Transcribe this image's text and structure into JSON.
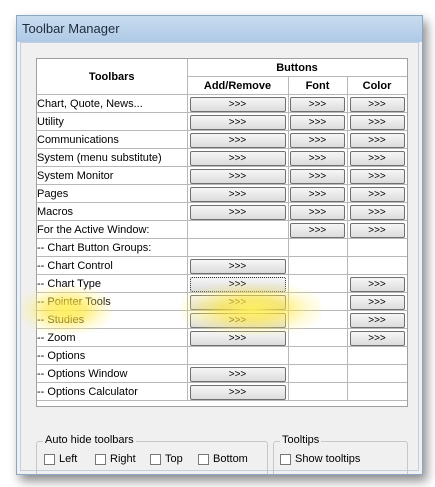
{
  "window": {
    "title": "Toolbar Manager"
  },
  "table": {
    "toolbars_header": "Toolbars",
    "buttons_header": "Buttons",
    "columns": [
      "Add/Remove",
      "Font",
      "Color"
    ],
    "button_label": ">>>",
    "rows": [
      {
        "label": "Chart, Quote, News...",
        "add": true,
        "font": true,
        "color": true
      },
      {
        "label": "Utility",
        "add": true,
        "font": true,
        "color": true
      },
      {
        "label": "Communications",
        "add": true,
        "font": true,
        "color": true
      },
      {
        "label": "System (menu substitute)",
        "add": true,
        "font": true,
        "color": true
      },
      {
        "label": "System Monitor",
        "add": true,
        "font": true,
        "color": true
      },
      {
        "label": "Pages",
        "add": true,
        "font": true,
        "color": true
      },
      {
        "label": "Macros",
        "add": true,
        "font": true,
        "color": true
      },
      {
        "label": "For the Active Window:",
        "add": false,
        "font": true,
        "color": true
      },
      {
        "label": "-- Chart Button Groups:",
        "add": false,
        "font": false,
        "color": false
      },
      {
        "label": "-- Chart Control",
        "add": true,
        "font": false,
        "color": false
      },
      {
        "label": "-- Chart Type",
        "add": true,
        "font": false,
        "color": true,
        "focused": true
      },
      {
        "label": "-- Pointer Tools",
        "add": true,
        "font": false,
        "color": true
      },
      {
        "label": "-- Studies",
        "add": true,
        "font": false,
        "color": true
      },
      {
        "label": "-- Zoom",
        "add": true,
        "font": false,
        "color": true
      },
      {
        "label": "-- Options",
        "add": false,
        "font": false,
        "color": false
      },
      {
        "label": "-- Options Window",
        "add": true,
        "font": false,
        "color": false
      },
      {
        "label": "-- Options Calculator",
        "add": true,
        "font": false,
        "color": false
      }
    ]
  },
  "auto_hide": {
    "legend": "Auto hide toolbars",
    "options": [
      {
        "label": "Left",
        "checked": false
      },
      {
        "label": "Right",
        "checked": false
      },
      {
        "label": "Top",
        "checked": false
      },
      {
        "label": "Bottom",
        "checked": false
      }
    ]
  },
  "tooltips": {
    "legend": "Tooltips",
    "option": {
      "label": "Show tooltips",
      "checked": false
    }
  },
  "highlight_color": "#fff05a"
}
